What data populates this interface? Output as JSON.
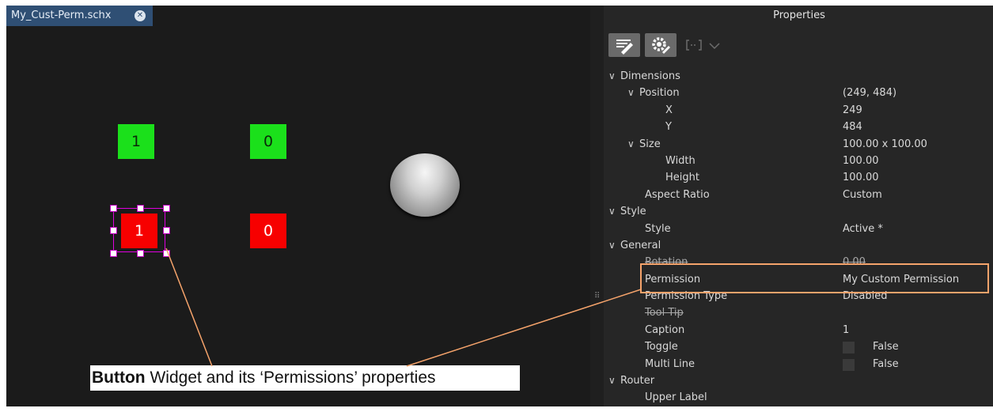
{
  "tab": {
    "title": "My_Cust-Perm.schx"
  },
  "widgets": [
    {
      "name": "green-button-1",
      "label": "1"
    },
    {
      "name": "green-button-0",
      "label": "0"
    },
    {
      "name": "red-button-1",
      "label": "1"
    },
    {
      "name": "red-button-0",
      "label": "0"
    }
  ],
  "annotation": {
    "bold": "Button",
    "rest": " Widget and its ‘Permissions’ properties"
  },
  "properties": {
    "title": "Properties",
    "toolbar": [
      "edit-properties-icon",
      "settings-gear-icon",
      "script-icon",
      "chevron-down-icon"
    ],
    "rows": [
      {
        "key": "Dimensions",
        "value": "",
        "chevron": true
      },
      {
        "key": "Position",
        "value": "(249, 484)",
        "chevron": true
      },
      {
        "key": "X",
        "value": "249"
      },
      {
        "key": "Y",
        "value": "484"
      },
      {
        "key": "Size",
        "value": "100.00 x 100.00",
        "chevron": true
      },
      {
        "key": "Width",
        "value": "100.00"
      },
      {
        "key": "Height",
        "value": "100.00"
      },
      {
        "key": "Aspect Ratio",
        "value": "Custom"
      },
      {
        "key": "Style",
        "value": "",
        "chevron": true
      },
      {
        "key": "Style",
        "value": "Active *"
      },
      {
        "key": "General",
        "value": "",
        "chevron": true
      },
      {
        "key": "Rotation",
        "value": "0.00"
      },
      {
        "key": "Permission",
        "value": "My Custom Permission"
      },
      {
        "key": "Permission Type",
        "value": "Disabled"
      },
      {
        "key": "Tool Tip",
        "value": ""
      },
      {
        "key": "Caption",
        "value": "1"
      },
      {
        "key": "Toggle",
        "value": "False"
      },
      {
        "key": "Multi Line",
        "value": "False"
      },
      {
        "key": "Router",
        "value": "",
        "chevron": true
      },
      {
        "key": "Upper Label",
        "value": ""
      }
    ]
  },
  "colors": {
    "highlight": "#f5a36b",
    "tab": "#2f4f74",
    "green": "#1be01b",
    "red": "#f70000"
  }
}
